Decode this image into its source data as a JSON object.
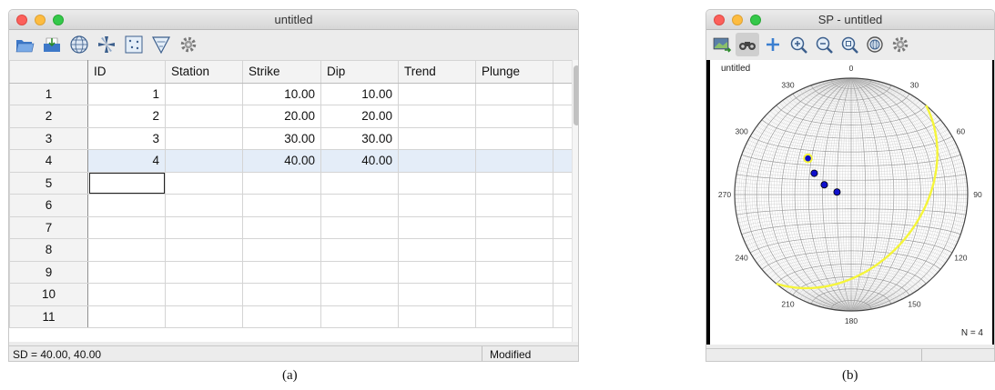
{
  "window_a": {
    "title": "untitled",
    "toolbar": [
      "open-icon",
      "save-icon",
      "globe-icon",
      "rose-icon",
      "density-icon",
      "triangle-icon",
      "settings-gear-icon"
    ],
    "columns": [
      "",
      "ID",
      "Station",
      "Strike",
      "Dip",
      "Trend",
      "Plunge"
    ],
    "rows": [
      {
        "n": "1",
        "id": "1",
        "station": "",
        "strike": "10.00",
        "dip": "10.00",
        "trend": "",
        "plunge": ""
      },
      {
        "n": "2",
        "id": "2",
        "station": "",
        "strike": "20.00",
        "dip": "20.00",
        "trend": "",
        "plunge": ""
      },
      {
        "n": "3",
        "id": "3",
        "station": "",
        "strike": "30.00",
        "dip": "30.00",
        "trend": "",
        "plunge": ""
      },
      {
        "n": "4",
        "id": "4",
        "station": "",
        "strike": "40.00",
        "dip": "40.00",
        "trend": "",
        "plunge": ""
      },
      {
        "n": "5",
        "id": "",
        "station": "",
        "strike": "",
        "dip": "",
        "trend": "",
        "plunge": ""
      },
      {
        "n": "6",
        "id": "",
        "station": "",
        "strike": "",
        "dip": "",
        "trend": "",
        "plunge": ""
      },
      {
        "n": "7",
        "id": "",
        "station": "",
        "strike": "",
        "dip": "",
        "trend": "",
        "plunge": ""
      },
      {
        "n": "8",
        "id": "",
        "station": "",
        "strike": "",
        "dip": "",
        "trend": "",
        "plunge": ""
      },
      {
        "n": "9",
        "id": "",
        "station": "",
        "strike": "",
        "dip": "",
        "trend": "",
        "plunge": ""
      },
      {
        "n": "10",
        "id": "",
        "station": "",
        "strike": "",
        "dip": "",
        "trend": "",
        "plunge": ""
      },
      {
        "n": "11",
        "id": "",
        "station": "",
        "strike": "",
        "dip": "",
        "trend": "",
        "plunge": ""
      }
    ],
    "selected_row": 4,
    "status_left": "SD = 40.00, 40.00",
    "status_right": "Modified"
  },
  "window_b": {
    "title": "SP - untitled",
    "toolbar": [
      "export-image-icon",
      "binoculars-icon",
      "plus-icon",
      "zoom-in-icon",
      "zoom-out-icon",
      "zoom-fit-icon",
      "rotate-icon",
      "settings-gear-icon"
    ],
    "plot_title": "untitled",
    "count_label": "N = 4",
    "azimuth_labels": [
      "0",
      "30",
      "60",
      "90",
      "120",
      "150",
      "180",
      "210",
      "240",
      "270",
      "300",
      "330"
    ],
    "poles": [
      {
        "strike": 10,
        "dip": 10
      },
      {
        "strike": 20,
        "dip": 20
      },
      {
        "strike": 30,
        "dip": 30
      },
      {
        "strike": 40,
        "dip": 40
      }
    ],
    "highlight_plane": {
      "strike": 40,
      "dip": 40
    },
    "colors": {
      "pole_fill": "#1010cc",
      "highlight": "#f5f53a",
      "grid": "#c4c4c4"
    }
  },
  "captions": [
    "(a)",
    "(b)"
  ]
}
